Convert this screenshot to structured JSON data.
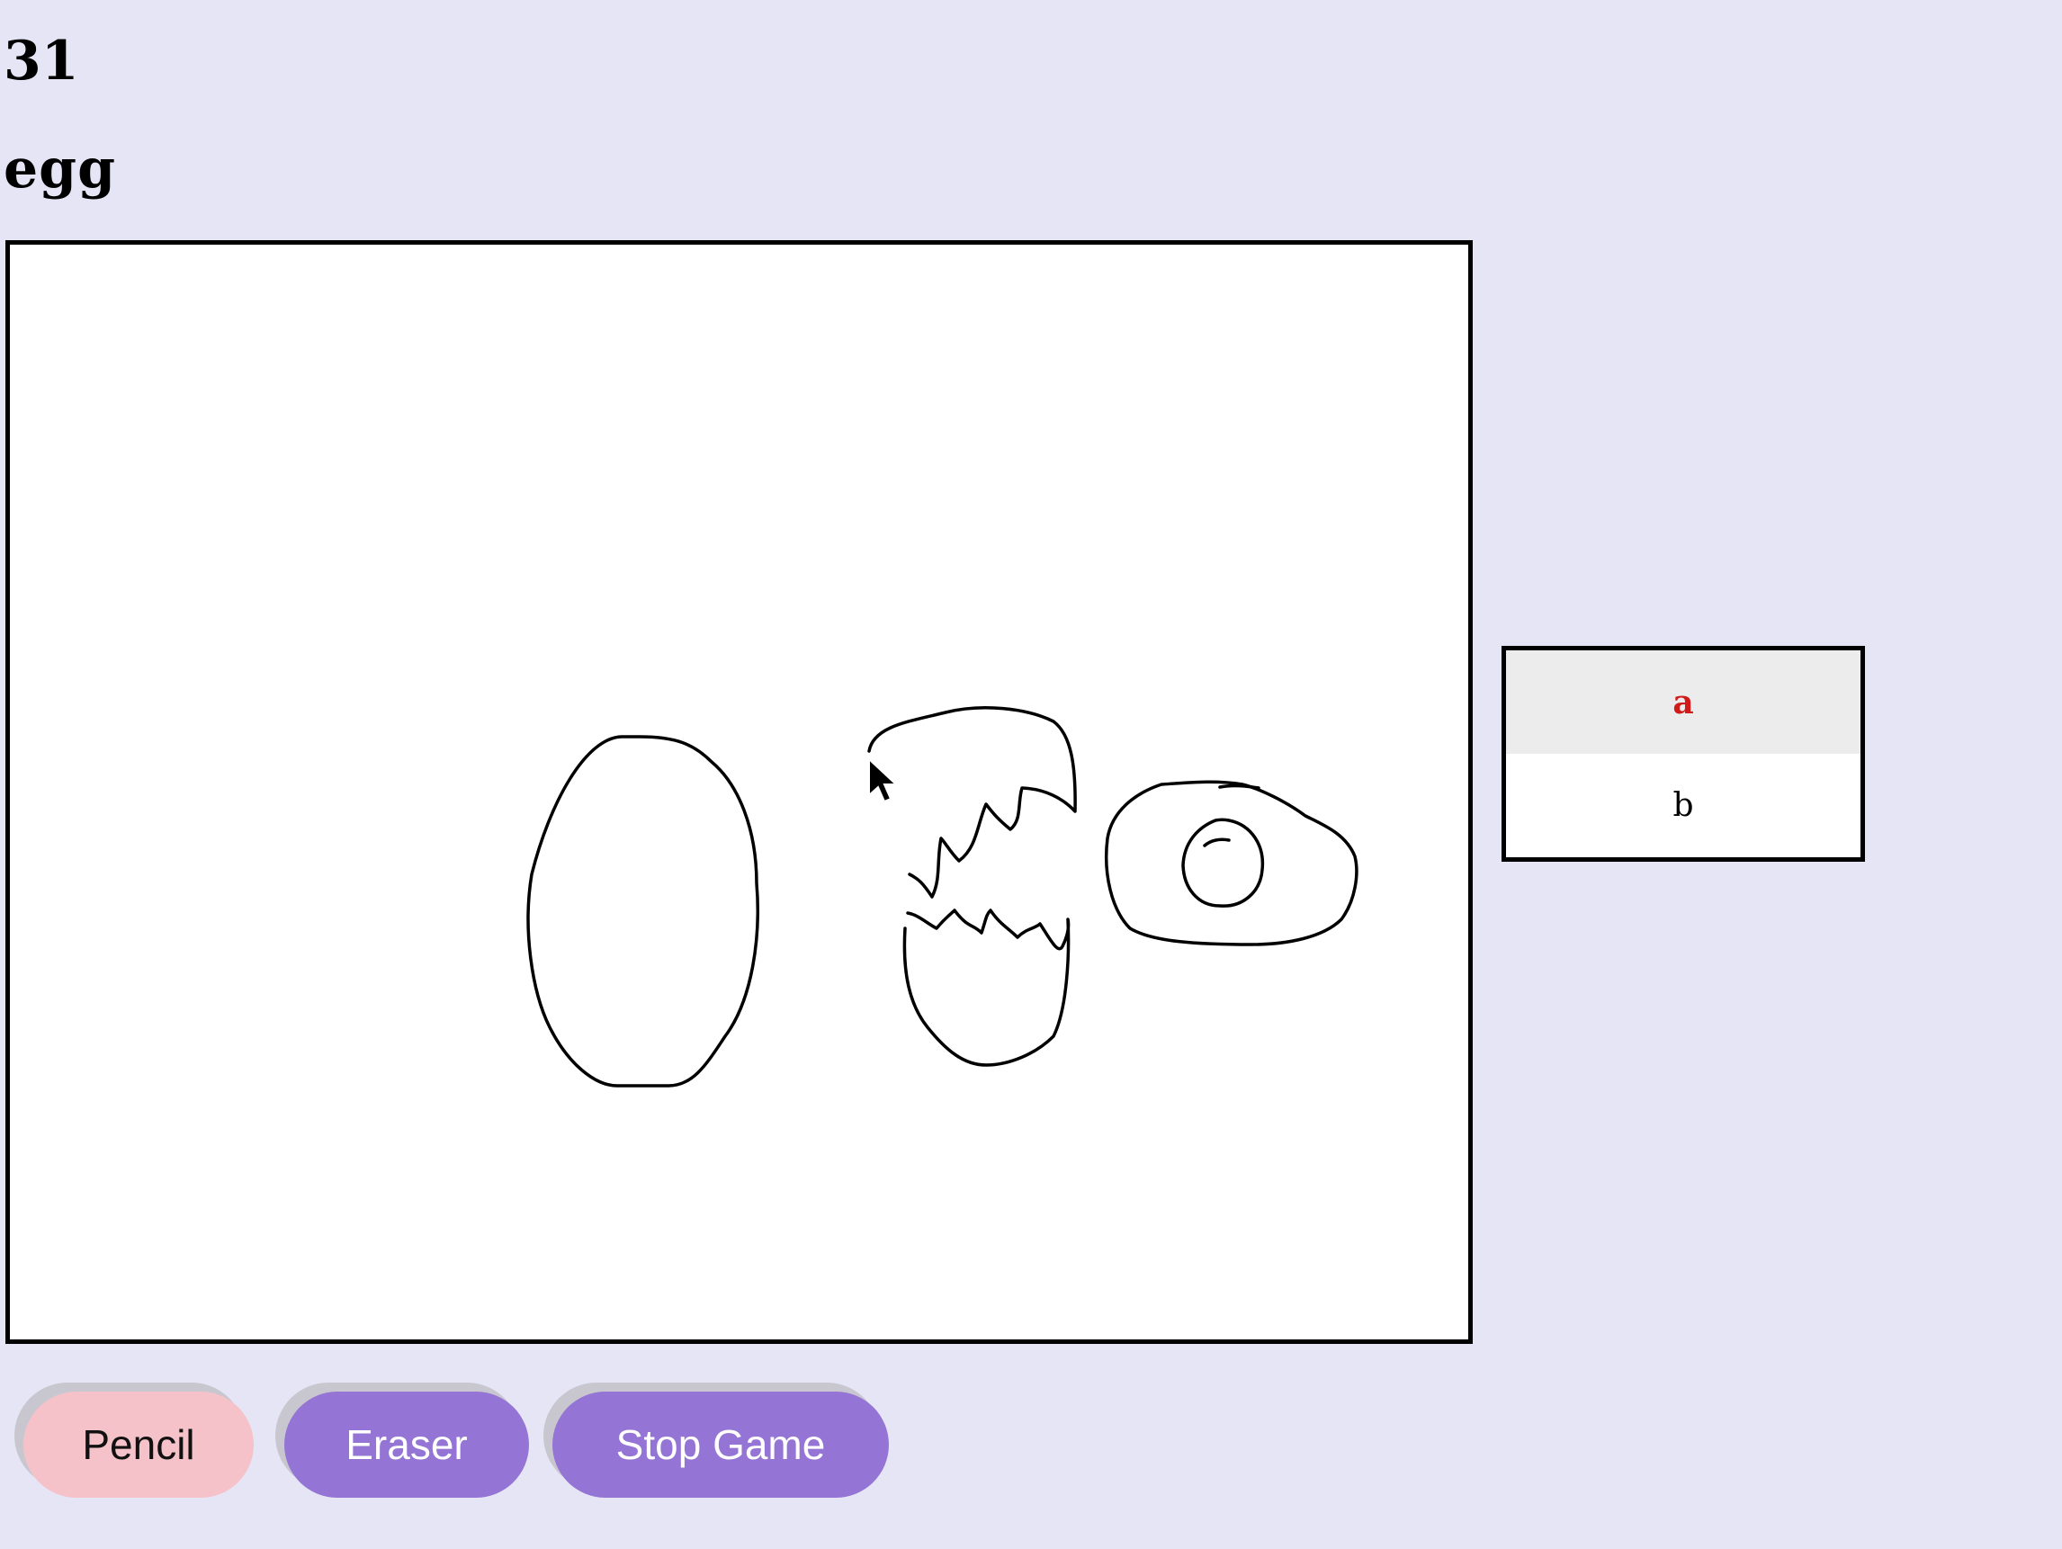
{
  "game": {
    "timer": "31",
    "word": "egg"
  },
  "players": [
    {
      "name": "a",
      "active": true
    },
    {
      "name": "b",
      "active": false
    }
  ],
  "toolbar": {
    "pencil_label": "Pencil",
    "eraser_label": "Eraser",
    "stop_label": "Stop Game"
  },
  "colors": {
    "background": "#e6e5f6",
    "pencil_button": "#f5c2c9",
    "action_button": "#9474d4",
    "active_player_text": "#d11a1a"
  }
}
